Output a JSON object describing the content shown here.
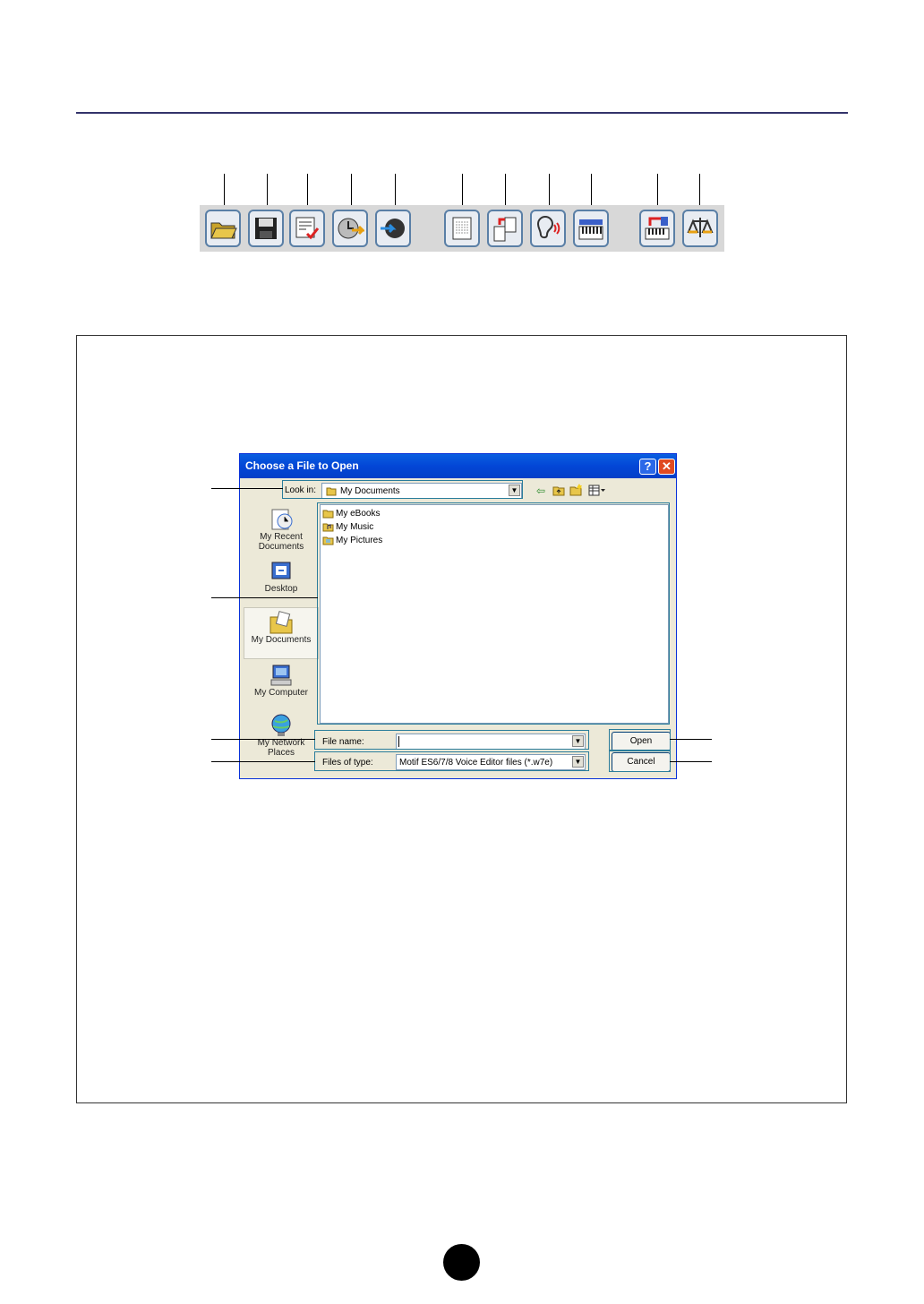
{
  "toolbar": {
    "icons": [
      "open-folder-icon",
      "save-disk-icon",
      "checklist-icon",
      "clock-arrow-icon",
      "compass-arrow-icon",
      "grid-list-icon",
      "transfer-arrows-icon",
      "ear-sound-icon",
      "keyboard-icon",
      "keyboard-transfer-icon",
      "compare-scale-icon"
    ]
  },
  "dialog": {
    "title": "Choose a File to Open",
    "help_glyph": "?",
    "close_glyph": "✕",
    "look_in_label": "Look in:",
    "look_in_value": "My Documents",
    "places": [
      "My Recent Documents",
      "Desktop",
      "My Documents",
      "My Computer",
      "My Network Places"
    ],
    "files": [
      "My eBooks",
      "My Music",
      "My Pictures"
    ],
    "file_name_label": "File name:",
    "file_name_value": "",
    "files_of_type_label": "Files of type:",
    "files_of_type_value": "Motif ES6/7/8 Voice Editor files (*.w7e)",
    "open_button": "Open",
    "cancel_button": "Cancel"
  },
  "colors": {
    "accent": "#0a5fe0",
    "callout": "#2a7d9b",
    "rule": "#33336a"
  }
}
